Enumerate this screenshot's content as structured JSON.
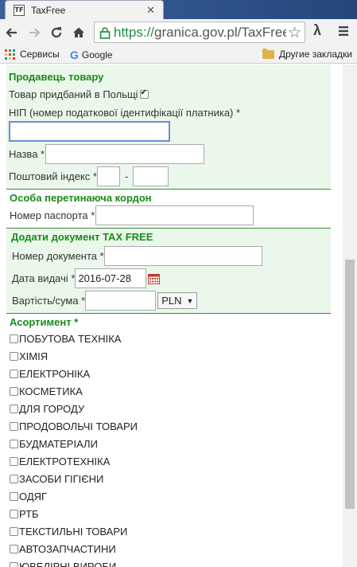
{
  "browser": {
    "tab_title": "TaxFree",
    "favicon_text": "TF",
    "url_scheme": "https://",
    "url_rest": "granica.gov.pl/TaxFree,",
    "bookmarks": [
      {
        "label": "Сервисы",
        "icon": "apps-icon"
      },
      {
        "label": "Google",
        "icon": "google-icon"
      }
    ],
    "other_bookmarks": "Другие закладки"
  },
  "seller": {
    "title": "Продавець товару",
    "bought_in_poland_label": "Товар придбаний в Польщі",
    "bought_in_poland_checked": true,
    "nip_label": "НІП (номер податкової ідентифікації платника) *",
    "nip_value": "",
    "name_label": "Назва *",
    "name_value": "",
    "postcode_label": "Поштовий індекс *",
    "postcode_sep": "-",
    "postcode_part1": "",
    "postcode_part2": ""
  },
  "traveller": {
    "title": "Особа перетинаюча кордон",
    "passport_label": "Номер паспорта *",
    "passport_value": ""
  },
  "document": {
    "title": "Додати документ TAX FREE",
    "doc_number_label": "Номер документа *",
    "doc_number_value": "",
    "issue_date_label": "Дата видачі *",
    "issue_date_value": "2016-07-28",
    "amount_label": "Вартість/сума *",
    "amount_value": "",
    "currency": "PLN"
  },
  "assortment": {
    "title": "Асортимент *",
    "items": [
      "ПОБУТОВА ТЕХНІКА",
      "ХІМІЯ",
      "ЕЛЕКТРОНІКА",
      "КОСМЕТИКА",
      "ДЛЯ ГОРОДУ",
      "ПРОДОВОЛЬЧІ ТОВАРИ",
      "БУДМАТЕРІАЛИ",
      "ЕЛЕКТРОТЕХНІКА",
      "ЗАСОБИ ГІГІЄНИ",
      "ОДЯГ",
      "РТБ",
      "ТЕКСТИЛЬНІ ТОВАРИ",
      "АВТОЗАПЧАСТИНИ",
      "ЮВЕЛІРНІ ВИРОБИ"
    ]
  },
  "colors": {
    "section_title": "#1a8a1a",
    "section_bg": "#ebf7eb",
    "url_secure": "#1e8e3e"
  }
}
